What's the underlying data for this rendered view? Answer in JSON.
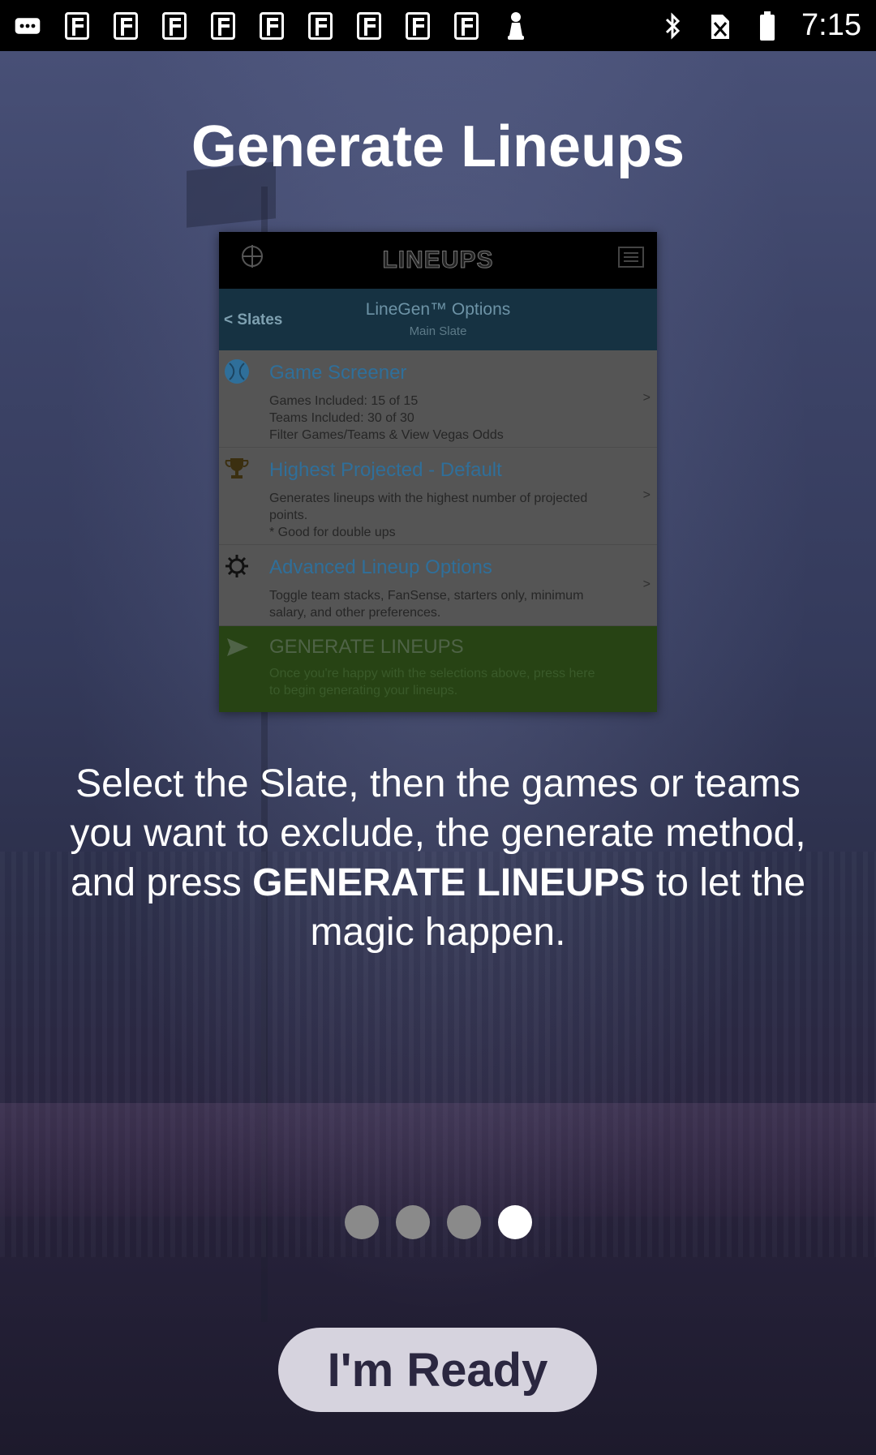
{
  "status_bar": {
    "time": "7:15",
    "notification_icons": [
      "more-icon",
      "app-f-icon",
      "app-f-icon",
      "app-f-icon",
      "app-f-icon",
      "app-f-icon",
      "app-f-icon",
      "app-f-icon",
      "app-f-icon",
      "app-f-icon",
      "pawn-icon"
    ],
    "right_icons": [
      "bluetooth-icon",
      "no-sim-icon",
      "battery-icon"
    ]
  },
  "onboarding": {
    "title": "Generate Lineups",
    "description_part1": "Select the Slate, then the games or teams you want to exclude, the generate method, and press ",
    "description_bold": "GENERATE LINEUPS",
    "description_part2": " to let the magic happen.",
    "page_count": 4,
    "active_page": 4,
    "ready_button": "I'm Ready"
  },
  "preview": {
    "app_title": "LINEUPS",
    "back_label": "< Slates",
    "nav_title": "LineGen™ Options",
    "nav_subtitle": "Main Slate",
    "items": [
      {
        "icon": "baseball-icon",
        "title": "Game Screener",
        "lines": [
          "Games Included: 15 of 15",
          "Teams Included: 30 of 30",
          "Filter Games/Teams & View Vegas Odds"
        ],
        "chevron": ">"
      },
      {
        "icon": "trophy-icon",
        "title": "Highest Projected - Default",
        "lines": [
          "Generates lineups with the highest number of projected",
          "points.",
          "* Good for double ups"
        ],
        "chevron": ">"
      },
      {
        "icon": "gear-icon",
        "title": "Advanced Lineup Options",
        "lines": [
          "Toggle team stacks, FanSense, starters only, minimum",
          "salary, and other preferences."
        ],
        "chevron": ">"
      }
    ],
    "generate": {
      "icon": "send-icon",
      "title": "GENERATE LINEUPS",
      "lines": [
        "Once you're happy with the selections above, press here",
        "to begin generating your lineups."
      ]
    }
  },
  "colors": {
    "accent_blue": "#2f6f9a",
    "generate_green": "#274314",
    "button_bg": "#d6d3de",
    "button_text": "#2b2740"
  }
}
